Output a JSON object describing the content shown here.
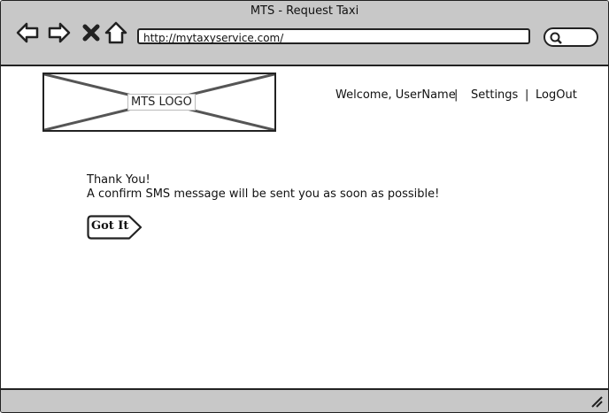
{
  "window": {
    "title": "MTS - Request Taxi"
  },
  "browser": {
    "url": "http://mytaxyservice.com/",
    "nav_icons": [
      "back-arrow-icon",
      "forward-arrow-icon",
      "close-x-icon",
      "home-icon"
    ]
  },
  "header": {
    "logo_text": "MTS LOGO",
    "welcome": "Welcome, UserName",
    "separator": "|",
    "settings": "Settings",
    "logout": "LogOut"
  },
  "main": {
    "line1": "Thank You!",
    "line2": "A confirm SMS message will be sent you as soon as possible!",
    "button_label": "Got It"
  }
}
